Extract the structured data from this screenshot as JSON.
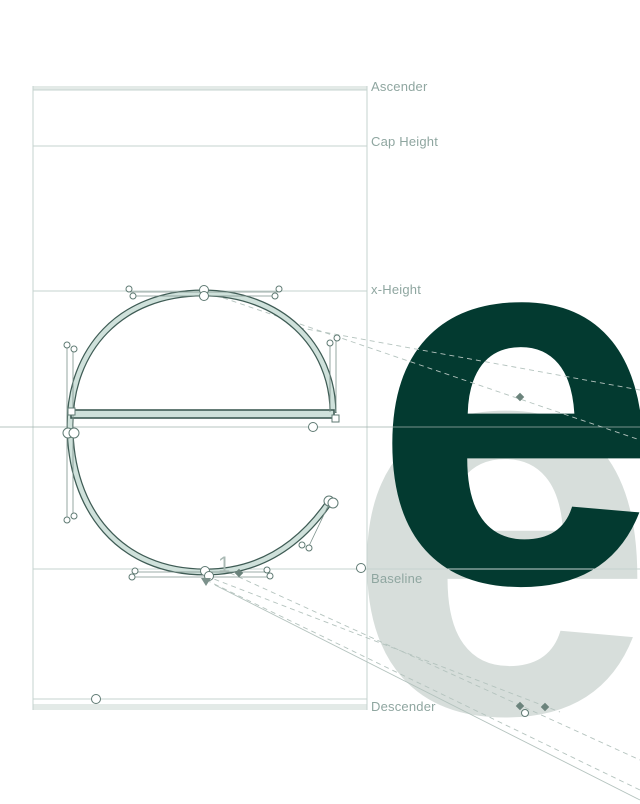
{
  "editor": {
    "metrics": {
      "ascender": "Ascender",
      "cap_height": "Cap Height",
      "x_height": "x-Height",
      "baseline": "Baseline",
      "descender": "Descender"
    },
    "glyph": {
      "character": "e",
      "start_point_index": "1"
    },
    "colors": {
      "preview_fill": "#033a30",
      "shadow_fill": "#d7dedb",
      "outline_fill": "#cfe1db",
      "outline_stroke": "#3f5c55",
      "metric_line": "#c6d3cf",
      "label_text": "#8fa6a0"
    }
  }
}
